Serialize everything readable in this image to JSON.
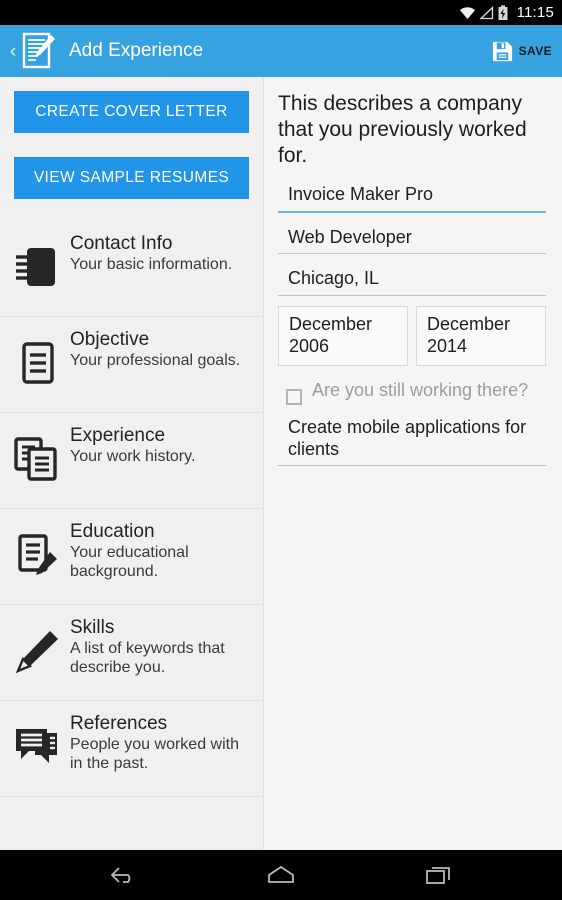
{
  "statusbar": {
    "time": "11:15",
    "icons": [
      "wifi-icon",
      "signal-icon",
      "battery-charging-icon"
    ]
  },
  "appbar": {
    "back_label": "‹",
    "app_icon": "document-pencil-icon",
    "title": "Add Experience",
    "save_label": "SAVE",
    "save_icon": "floppy-disk-icon",
    "background_color": "#37a2e0"
  },
  "sidebar": {
    "buttons": [
      {
        "label": "CREATE COVER LETTER",
        "color": "#2196e8"
      },
      {
        "label": "VIEW SAMPLE RESUMES",
        "color": "#2196e8"
      }
    ],
    "items": [
      {
        "title": "Contact Info",
        "subtitle": "Your basic information.",
        "icon": "address-book-icon"
      },
      {
        "title": "Objective",
        "subtitle": "Your professional goals.",
        "icon": "document-lines-icon"
      },
      {
        "title": "Experience",
        "subtitle": "Your work history.",
        "icon": "stacked-documents-icon"
      },
      {
        "title": "Education",
        "subtitle": "Your educational background.",
        "icon": "document-pencil-icon"
      },
      {
        "title": "Skills",
        "subtitle": "A list of keywords that describe you.",
        "icon": "pencil-icon"
      },
      {
        "title": "References",
        "subtitle": "People you worked with in the past.",
        "icon": "speech-bubbles-icon"
      }
    ]
  },
  "detail": {
    "intro": "This describes a company that you previously worked for.",
    "fields": [
      {
        "name": "company",
        "value": "Invoice Maker Pro",
        "focused": true
      },
      {
        "name": "job-title",
        "value": "Web Developer",
        "focused": false
      },
      {
        "name": "location",
        "value": "Chicago, IL",
        "focused": false
      }
    ],
    "dates": {
      "start": "December 2006",
      "end": "December 2014"
    },
    "still_working": {
      "label": "Are you still working there?",
      "checked": false
    },
    "description": {
      "name": "description",
      "value": "Create mobile applications for clients"
    }
  },
  "navbar": {
    "buttons": [
      {
        "name": "back",
        "icon": "back-arrow-icon"
      },
      {
        "name": "home",
        "icon": "home-icon"
      },
      {
        "name": "recents",
        "icon": "recents-icon"
      }
    ]
  }
}
